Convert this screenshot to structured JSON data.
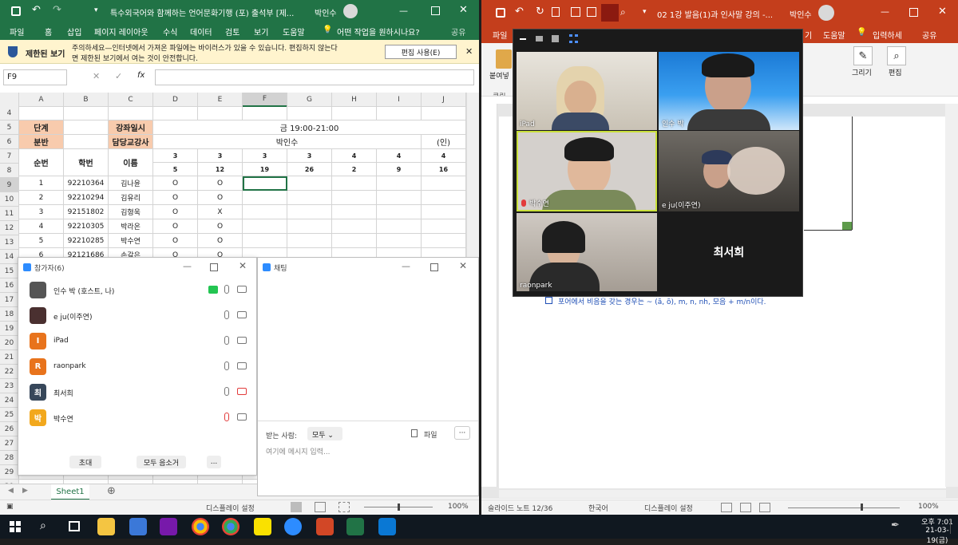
{
  "excel": {
    "title": "특수외국어와 함께하는 언어문화기행 (포) 출석부  [제...",
    "user": "박인수",
    "menu": [
      "파일",
      "홈",
      "삽입",
      "페이지 레이아웃",
      "수식",
      "데이터",
      "검토",
      "보기",
      "도움말",
      "어떤 작업을 원하시나요?",
      "공유"
    ],
    "warning": {
      "label": "제한된 보기",
      "text_line1": "주의하세요—인터넷에서 가져온 파일에는 바이러스가 있을 수 있습니다. 편집하지 않는다",
      "text_line2": "면 제한된 보기에서 여는 것이 안전합니다.",
      "button": "편집 사용(E)"
    },
    "name_box": "F9",
    "fx": "fx",
    "col_headers": [
      "A",
      "B",
      "C",
      "D",
      "E",
      "F",
      "G",
      "H",
      "I",
      "J"
    ],
    "row_numbers": [
      "4",
      "5",
      "6",
      "7",
      "8",
      "9",
      "10",
      "11",
      "12",
      "13",
      "14",
      "15",
      "16",
      "17",
      "18",
      "19",
      "20",
      "21",
      "22",
      "23",
      "24",
      "25",
      "26",
      "27",
      "28",
      "29",
      "30"
    ],
    "sheet": {
      "r5_a": "단계",
      "r5_c": "강좌일시",
      "r5_time": "금 19:00-21:00",
      "r6_a": "분반",
      "r6_c": "담당교강사",
      "r6_teacher": "박인수",
      "r6_j": "(인)",
      "hdr_no": "순번",
      "hdr_id": "학번",
      "hdr_name": "이름",
      "months": [
        "3",
        "3",
        "3",
        "3",
        "4",
        "4",
        "4"
      ],
      "days": [
        "5",
        "12",
        "19",
        "26",
        "2",
        "9",
        "16"
      ],
      "students": [
        {
          "no": "1",
          "id": "92210364",
          "name": "김나윤",
          "d": "O",
          "e": "O"
        },
        {
          "no": "2",
          "id": "92210294",
          "name": "김유리",
          "d": "O",
          "e": "O"
        },
        {
          "no": "3",
          "id": "92151802",
          "name": "김형욱",
          "d": "O",
          "e": "X"
        },
        {
          "no": "4",
          "id": "92210305",
          "name": "박라온",
          "d": "O",
          "e": "O"
        },
        {
          "no": "5",
          "id": "92210285",
          "name": "박수연",
          "d": "O",
          "e": "O"
        },
        {
          "no": "6",
          "id": "92121686",
          "name": "손갈은",
          "d": "O",
          "e": "O"
        }
      ]
    },
    "sheet_tab": "Sheet1",
    "status_display": "디스플레이 설정",
    "zoom": "100%"
  },
  "participants": {
    "title": "참가자(6)",
    "list": [
      {
        "name": "인수 박 (호스트, 나)",
        "initial": "",
        "color": "#555555"
      },
      {
        "name": "e ju(이주연)",
        "initial": "",
        "color": "#4a3030"
      },
      {
        "name": "iPad",
        "initial": "I",
        "color": "#e8731c"
      },
      {
        "name": "raonpark",
        "initial": "R",
        "color": "#e8731c"
      },
      {
        "name": "최서희",
        "initial": "최",
        "color": "#37475a"
      },
      {
        "name": "박수연",
        "initial": "박",
        "color": "#f2a81d"
      }
    ],
    "invite": "초대",
    "mute_all": "모두 음소거",
    "more": "..."
  },
  "chat": {
    "title": "채팅",
    "to_label": "받는 사람:",
    "to_value": "모두",
    "file": "파일",
    "more": "···",
    "placeholder": "여기에 메시지 입력..."
  },
  "ppt": {
    "title": "02 1강 발음(1)과 인사말 강의 -...",
    "user": "박인수",
    "menu_left": "파일",
    "menu_right": [
      "기",
      "도움말",
      "입력하세",
      "공유"
    ],
    "ribbon": {
      "paste": "붙여넣",
      "clipboard": "클립",
      "draw": "그리기",
      "edit": "편집"
    },
    "slide_text": "포어에서 비음을 갖는 경우는 ~ (ã, õ), m, n, nh, 모음 + m/n이다.",
    "status_slide": "슬라이드 노트 12/36",
    "status_lang": "한국어",
    "status_display": "디스플레이 설정",
    "zoom": "100%"
  },
  "gallery": {
    "tiles": [
      {
        "name": "iPad"
      },
      {
        "name": "인수 박"
      },
      {
        "name": "박수연"
      },
      {
        "name": "e ju(이주연)"
      },
      {
        "name": "raonpark"
      },
      {
        "name": "최서희"
      }
    ]
  },
  "taskbar": {
    "time": "오후 7:01",
    "date": "21-03-19(금)"
  }
}
